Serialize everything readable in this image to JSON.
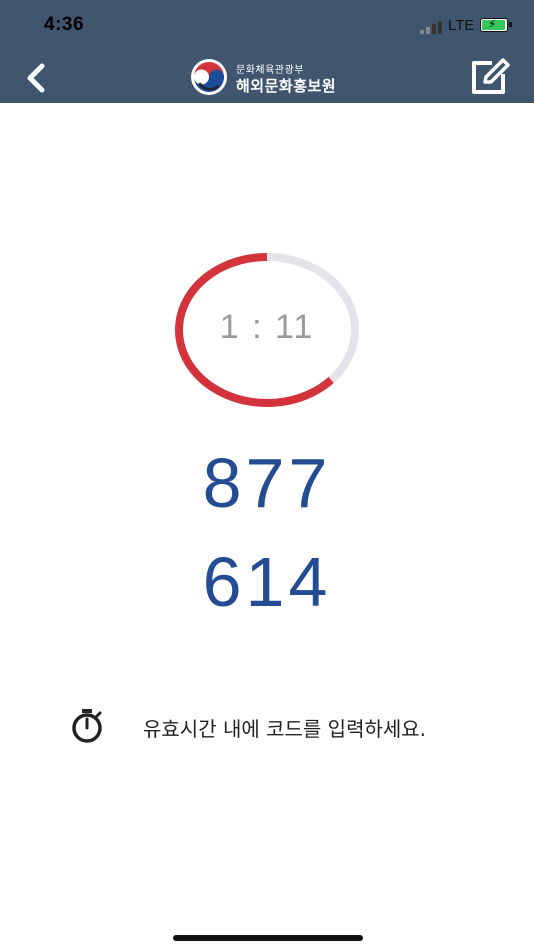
{
  "status_bar": {
    "time": "4:36",
    "network": "LTE"
  },
  "header": {
    "logo_sub": "문화체육관광부",
    "logo_main": "해외문화홍보원"
  },
  "timer": {
    "remaining": "1 : 11",
    "progress_fraction": 0.63,
    "ring_color": "#d3343c",
    "track_color": "#e3e4e8"
  },
  "otp": {
    "line1": "877",
    "line2": "614"
  },
  "hint": {
    "text": "유효시간 내에 코드를 입력하세요."
  },
  "colors": {
    "header_bg": "#40566f",
    "code_color": "#234c92"
  }
}
